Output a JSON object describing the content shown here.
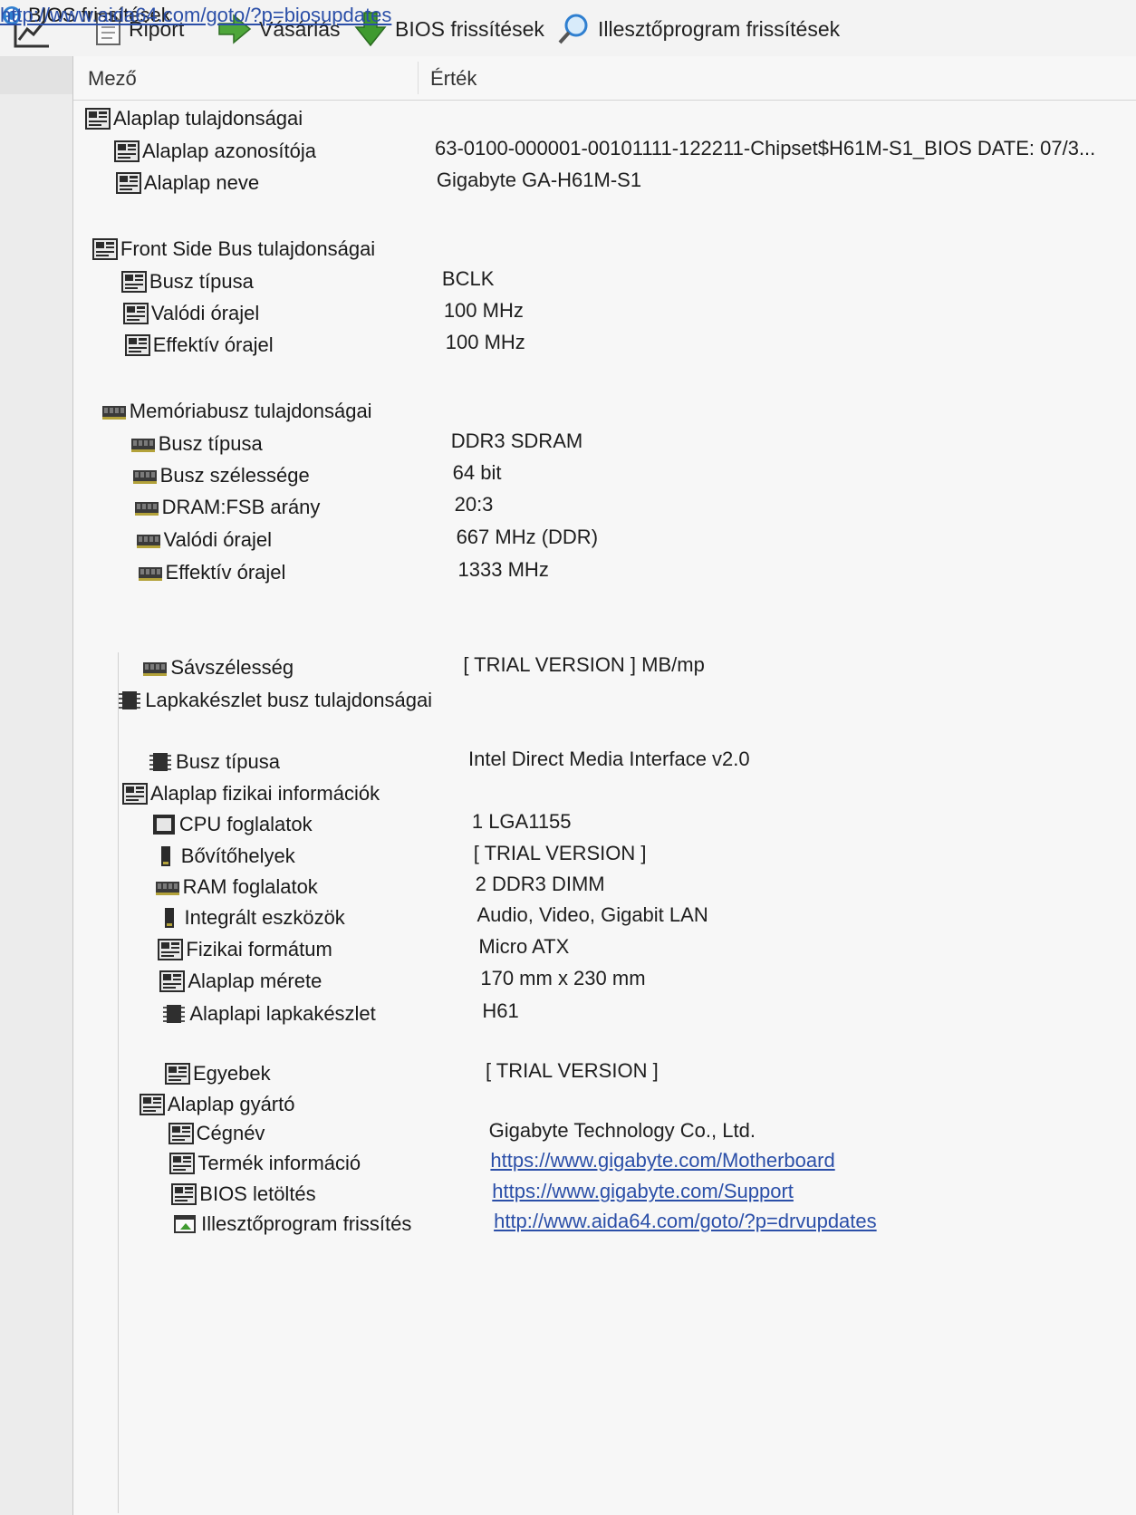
{
  "toolbar": {
    "chart_icon": "line-chart-icon",
    "buttons": [
      {
        "label": "Riport",
        "icon": "document-icon"
      },
      {
        "label": "Vásárlás",
        "icon": "green-arrow-icon"
      },
      {
        "label": "BIOS frissítések",
        "icon": "download-arrow-icon"
      },
      {
        "label": "Illesztőprogram frissítések",
        "icon": "magnifier-icon"
      }
    ]
  },
  "columns": {
    "field": "Mező",
    "value": "Érték"
  },
  "colors": {
    "link": "#2b4fa8",
    "download_arrow": "#3f9a2f",
    "magnifier": "#2f7fd0"
  },
  "rows": [
    {
      "field": "Alaplap tulajdonságai",
      "value": "",
      "icon": "motherboard-icon",
      "level": 0
    },
    {
      "field": "Alaplap azonosítója",
      "value": "63-0100-000001-00101111-122211-Chipset$H61M-S1_BIOS DATE: 07/3...",
      "icon": "motherboard-icon",
      "level": 1
    },
    {
      "field": "Alaplap neve",
      "value": "Gigabyte GA-H61M-S1",
      "icon": "motherboard-icon",
      "level": 1
    },
    {
      "field": "Front Side Bus tulajdonságai",
      "value": "",
      "icon": "motherboard-icon",
      "level": 0
    },
    {
      "field": "Busz típusa",
      "value": "BCLK",
      "icon": "motherboard-icon",
      "level": 1
    },
    {
      "field": "Valódi órajel",
      "value": "100 MHz",
      "icon": "motherboard-icon",
      "level": 1
    },
    {
      "field": "Effektív órajel",
      "value": "100 MHz",
      "icon": "motherboard-icon",
      "level": 1
    },
    {
      "field": "Memóriabusz tulajdonságai",
      "value": "",
      "icon": "ram-icon",
      "level": 0
    },
    {
      "field": "Busz típusa",
      "value": "DDR3 SDRAM",
      "icon": "ram-icon",
      "level": 1
    },
    {
      "field": "Busz szélessége",
      "value": "64 bit",
      "icon": "ram-icon",
      "level": 1
    },
    {
      "field": "DRAM:FSB arány",
      "value": "20:3",
      "icon": "ram-icon",
      "level": 1
    },
    {
      "field": "Valódi órajel",
      "value": "667 MHz (DDR)",
      "icon": "ram-icon",
      "level": 1
    },
    {
      "field": "Effektív órajel",
      "value": "1333 MHz",
      "icon": "ram-icon",
      "level": 1
    },
    {
      "field": "Sávszélesség",
      "value": "[ TRIAL VERSION ] MB/mp",
      "icon": "ram-icon",
      "level": 1
    },
    {
      "field": "Lapkakészlet busz tulajdonságai",
      "value": "",
      "icon": "chip-icon",
      "level": 0
    },
    {
      "field": "Busz típusa",
      "value": "Intel Direct Media Interface v2.0",
      "icon": "chip-icon",
      "level": 1
    },
    {
      "field": "Alaplap fizikai információk",
      "value": "",
      "icon": "motherboard-icon",
      "level": 0
    },
    {
      "field": "CPU foglalatok",
      "value": "1 LGA1155",
      "icon": "cpu-socket-icon",
      "level": 1
    },
    {
      "field": "Bővítőhelyek",
      "value": "[ TRIAL VERSION ]",
      "icon": "expansion-card-icon",
      "level": 1
    },
    {
      "field": "RAM foglalatok",
      "value": "2 DDR3 DIMM",
      "icon": "ram-icon",
      "level": 1
    },
    {
      "field": "Integrált eszközök",
      "value": "Audio, Video, Gigabit LAN",
      "icon": "expansion-card-icon",
      "level": 1
    },
    {
      "field": "Fizikai formátum",
      "value": "Micro ATX",
      "icon": "motherboard-icon",
      "level": 1
    },
    {
      "field": "Alaplap mérete",
      "value": "170 mm x 230 mm",
      "icon": "motherboard-icon",
      "level": 1
    },
    {
      "field": "Alaplapi lapkakészlet",
      "value": "H61",
      "icon": "chip-icon",
      "level": 1
    },
    {
      "field": "Egyebek",
      "value": "[ TRIAL VERSION ]",
      "icon": "motherboard-icon",
      "level": 1
    },
    {
      "field": "Alaplap gyártó",
      "value": "",
      "icon": "motherboard-icon",
      "level": 0
    },
    {
      "field": "Cégnév",
      "value": "Gigabyte Technology Co., Ltd.",
      "icon": "motherboard-icon",
      "level": 1
    },
    {
      "field": "Termék információ",
      "value": "https://www.gigabyte.com/Motherboard",
      "icon": "motherboard-icon",
      "level": 1,
      "link": true
    },
    {
      "field": "BIOS letöltés",
      "value": "https://www.gigabyte.com/Support",
      "icon": "motherboard-icon",
      "level": 1,
      "link": true
    },
    {
      "field": "Illesztőprogram frissítés",
      "value": "http://www.aida64.com/goto/?p=drvupdates",
      "icon": "driver-update-icon",
      "level": 1,
      "link": true
    },
    {
      "field": "BIOS frissítések",
      "value": "http://www.aida64.com/goto/?p=biosupdates",
      "icon": "bios-update-icon",
      "level": 1,
      "link": true
    }
  ]
}
